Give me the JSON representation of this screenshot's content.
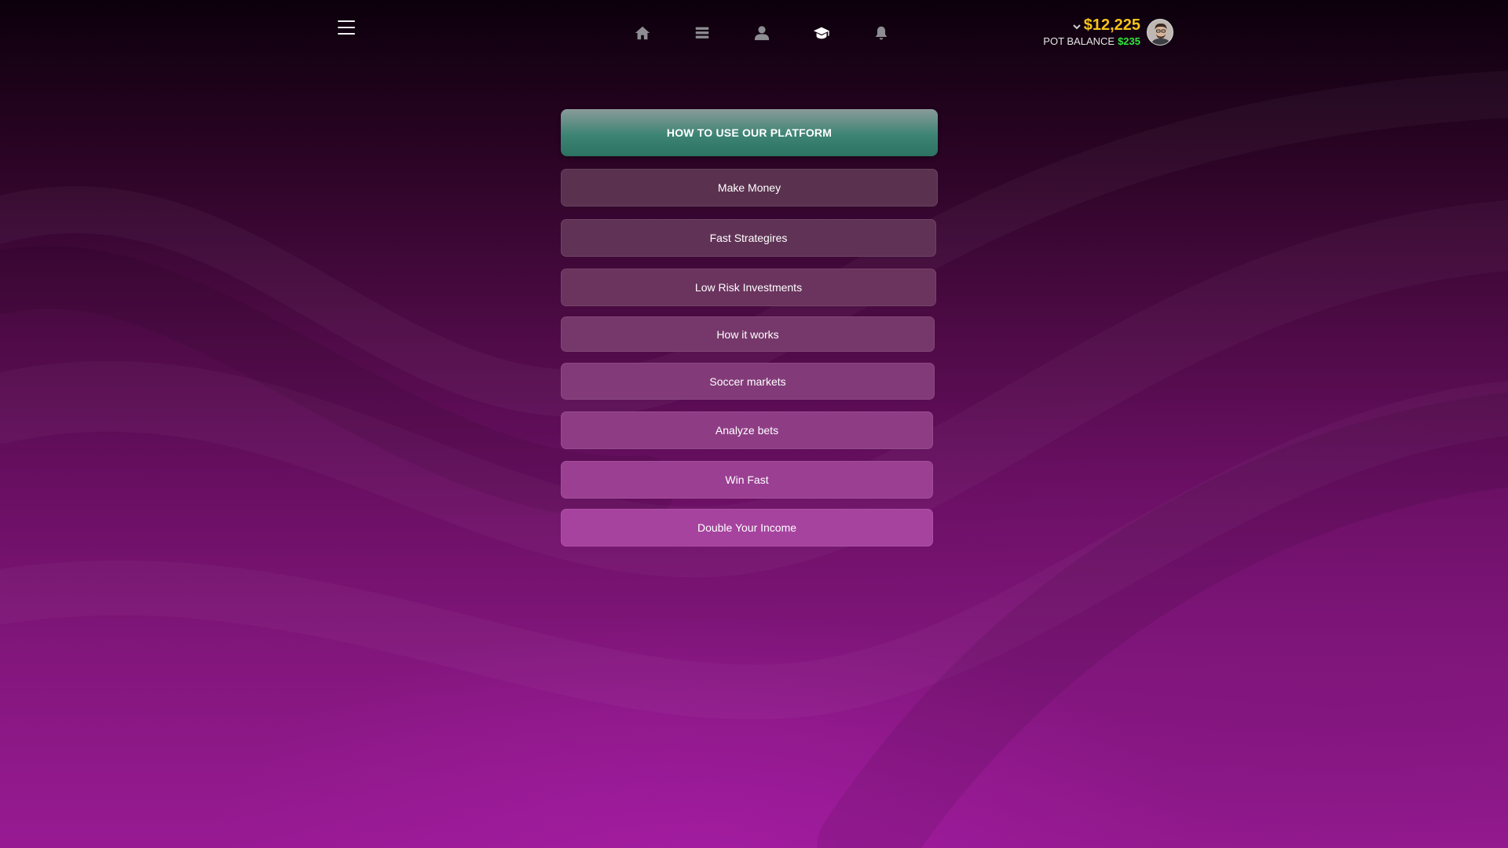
{
  "header": {
    "menu_icon": "hamburger-menu-icon",
    "nav": [
      {
        "icon": "home-icon",
        "active": false
      },
      {
        "icon": "list-icon",
        "active": false
      },
      {
        "icon": "user-icon",
        "active": false
      },
      {
        "icon": "graduation-cap-icon",
        "active": true
      },
      {
        "icon": "bell-icon",
        "active": false
      }
    ],
    "account": {
      "balance": "$12,225",
      "pot_label": "POT BALANCE",
      "pot_amount": "$235",
      "avatar_icon": "avatar"
    }
  },
  "main": {
    "title": "HOW TO USE OUR PLATFORM",
    "items": [
      {
        "label": "Make Money"
      },
      {
        "label": "Fast Strategires"
      },
      {
        "label": "Low Risk Investments"
      },
      {
        "label": "How it works"
      },
      {
        "label": "Soccer markets"
      },
      {
        "label": "Analyze bets"
      },
      {
        "label": "Win Fast"
      },
      {
        "label": "Double Your Income"
      }
    ]
  },
  "colors": {
    "balance": "#f5c518",
    "pot_amount": "#2ee83a",
    "header_button": "#3d8474"
  }
}
